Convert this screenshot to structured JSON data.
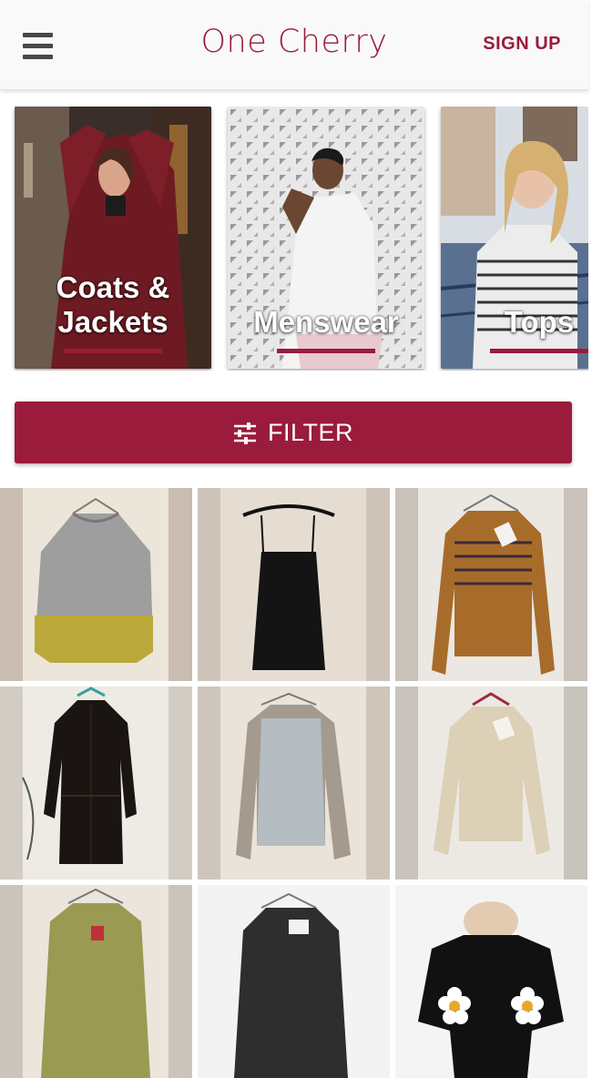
{
  "header": {
    "menu_icon": "hamburger-menu-icon",
    "brand": "One Cherry",
    "signup_label": "SIGN UP",
    "brand_color": "#9a1b3b"
  },
  "categories": [
    {
      "label_line1": "Coats &",
      "label_line2": "Jackets"
    },
    {
      "label_line1": "",
      "label_line2": "Menswear"
    },
    {
      "label_line1": "",
      "label_line2": "Tops"
    }
  ],
  "filter": {
    "label": "FILTER",
    "icon": "sliders-icon"
  },
  "products": [
    {
      "item": "grey and mustard knit sweater"
    },
    {
      "item": "black slip dress"
    },
    {
      "item": "mustard fair isle sweater"
    },
    {
      "item": "black shirt dress"
    },
    {
      "item": "grey raglan sweater"
    },
    {
      "item": "cream cable knit sweater"
    },
    {
      "item": "olive v-neck sweater"
    },
    {
      "item": "dark grey velvet top"
    },
    {
      "item": "black top with daisies"
    }
  ]
}
